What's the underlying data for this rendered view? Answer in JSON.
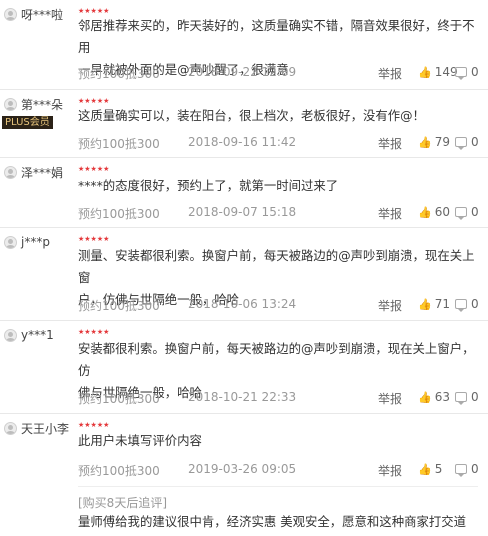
{
  "reviews": [
    {
      "user": "呀***啦",
      "plus": "",
      "stars": "★★★★★",
      "lines": [
        "邻居推荐来买的，昨天装好的，这质量确实不错，隔音效果很好，终于不用",
        "一早就被外面的是@声吵醒了，很满意"
      ],
      "spec": "预约100抵300",
      "date": "2018-09-22 12:09",
      "report": "举报",
      "likes": "149",
      "replies": "0"
    },
    {
      "user": "第***朵",
      "plus": "PLUS会员",
      "stars": "★★★★★",
      "lines": [
        "这质量确实可以，装在阳台，很上档次，老板很好，没有作@！"
      ],
      "spec": "预约100抵300",
      "date": "2018-09-16 11:42",
      "report": "举报",
      "likes": "79",
      "replies": "0"
    },
    {
      "user": "泽***娟",
      "plus": "",
      "stars": "★★★★★",
      "lines": [
        "****的态度很好，预约上了，就第一时间过来了"
      ],
      "spec": "预约100抵300",
      "date": "2018-09-07 15:18",
      "report": "举报",
      "likes": "60",
      "replies": "0"
    },
    {
      "user": "j***p",
      "plus": "",
      "stars": "★★★★★",
      "lines": [
        "测量、安装都很利索。换窗户前，每天被路边的@声吵到崩溃，现在关上窗",
        "户，仿佛与世隔绝一般，哈哈"
      ],
      "spec": "预约100抵300",
      "date": "2018-10-06 13:24",
      "report": "举报",
      "likes": "71",
      "replies": "0"
    },
    {
      "user": "y***1",
      "plus": "",
      "stars": "★★★★★",
      "lines": [
        "安装都很利索。换窗户前，每天被路边的@声吵到崩溃，现在关上窗户，仿",
        "佛与世隔绝一般，哈哈"
      ],
      "spec": "预约100抵300",
      "date": "2018-10-21 22:33",
      "report": "举报",
      "likes": "63",
      "replies": "0"
    },
    {
      "user": "天王小李",
      "plus": "",
      "stars": "★★★★★",
      "lines": [
        "此用户未填写评价内容"
      ],
      "spec": "预约100抵300",
      "date": "2019-03-26 09:05",
      "report": "举报",
      "likes": "5",
      "replies": "0",
      "followup_tag": "[购买8天后追评]",
      "followup_text": "量师傅给我的建议很中肯，经济实惠 美观安全，愿意和这种商家打交道"
    }
  ]
}
